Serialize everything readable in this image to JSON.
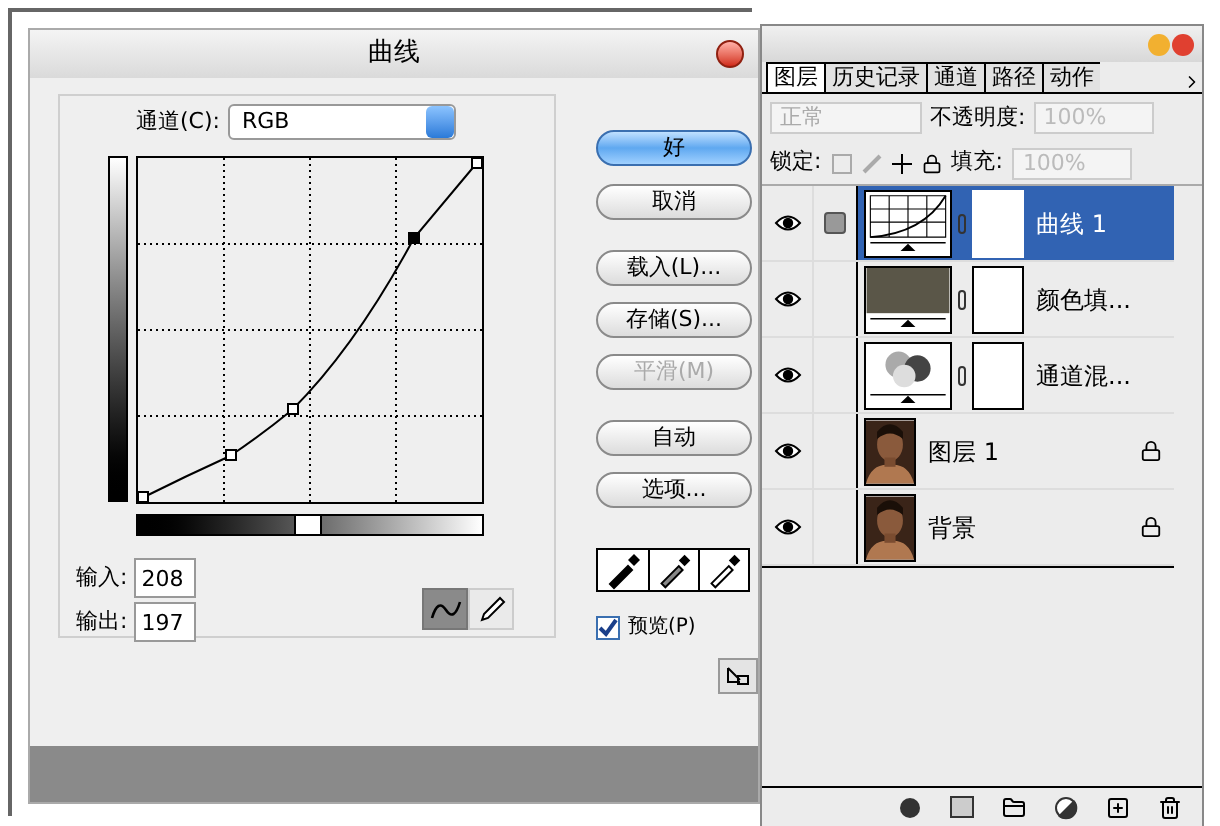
{
  "dialog": {
    "title": "曲线",
    "channel_label": "通道(C):",
    "channel_value": "RGB",
    "buttons": [
      {
        "label": "好",
        "kind": "default",
        "disabled": false
      },
      {
        "label": "取消",
        "kind": "normal",
        "disabled": false
      },
      {
        "label": "载入(L)...",
        "kind": "normal",
        "disabled": false
      },
      {
        "label": "存储(S)...",
        "kind": "normal",
        "disabled": false
      },
      {
        "label": "平滑(M)",
        "kind": "normal",
        "disabled": true
      },
      {
        "label": "自动",
        "kind": "normal",
        "disabled": false
      },
      {
        "label": "选项...",
        "kind": "normal",
        "disabled": false
      }
    ],
    "input_label": "输入:",
    "input_value": "208",
    "output_label": "输出:",
    "output_value": "197",
    "tools": [
      {
        "kind": "curve",
        "selected": true
      },
      {
        "kind": "pencil",
        "selected": false
      }
    ],
    "preview": {
      "label": "预览(P)",
      "checked": true
    }
  },
  "layers_panel": {
    "tabs": [
      {
        "label": "图层",
        "selected": true
      },
      {
        "label": "历史记录",
        "selected": false
      },
      {
        "label": "通道",
        "selected": false
      },
      {
        "label": "路径",
        "selected": false
      },
      {
        "label": "动作",
        "selected": false
      }
    ],
    "blend_mode": "正常",
    "opacity_label": "不透明度:",
    "opacity_value": "100%",
    "lock_label": "锁定:",
    "fill_label": "填充:",
    "fill_value": "100%",
    "layers": [
      {
        "name": "曲线 1",
        "kind": "curves",
        "selected": true,
        "visible": true,
        "locked": false
      },
      {
        "name": "颜色填...",
        "kind": "fill",
        "selected": false,
        "visible": true,
        "locked": false
      },
      {
        "name": "通道混...",
        "kind": "mixer",
        "selected": false,
        "visible": true,
        "locked": false
      },
      {
        "name": "图层 1",
        "selected": false,
        "visible": true,
        "locked": true
      },
      {
        "name": "背景",
        "selected": false,
        "visible": true,
        "locked": true
      }
    ]
  }
}
